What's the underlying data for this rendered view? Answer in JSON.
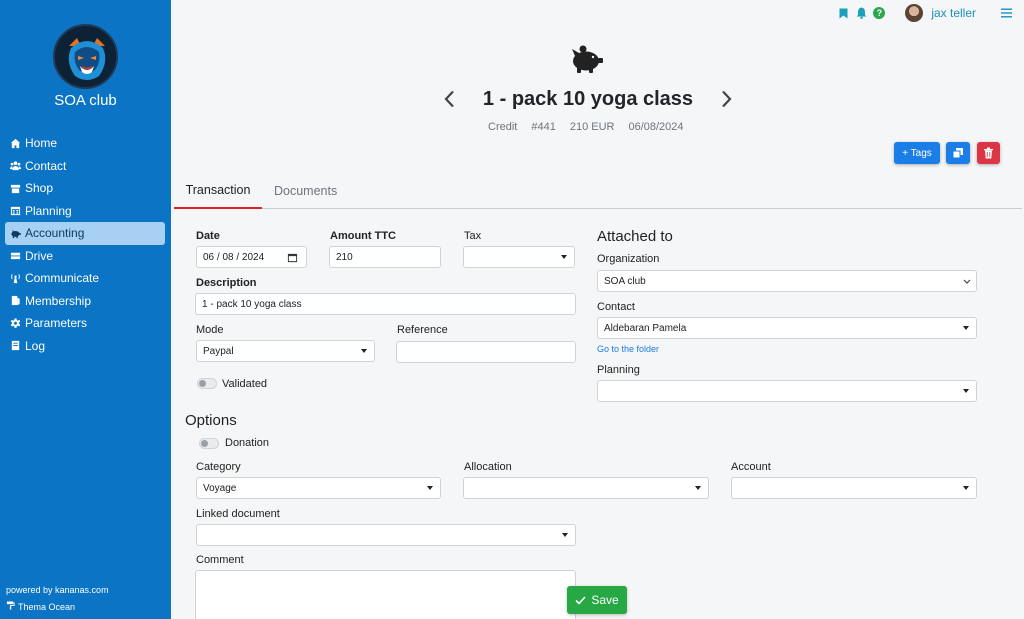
{
  "sidebar": {
    "club_name": "SOA club",
    "items": [
      {
        "label": "Home",
        "icon": "home-icon"
      },
      {
        "label": "Contact",
        "icon": "users-icon"
      },
      {
        "label": "Shop",
        "icon": "shop-icon"
      },
      {
        "label": "Planning",
        "icon": "calendar-icon"
      },
      {
        "label": "Accounting",
        "icon": "piggy-bank-icon"
      },
      {
        "label": "Drive",
        "icon": "drive-icon"
      },
      {
        "label": "Communicate",
        "icon": "broadcast-icon"
      },
      {
        "label": "Membership",
        "icon": "id-card-icon"
      },
      {
        "label": "Parameters",
        "icon": "gear-icon"
      },
      {
        "label": "Log",
        "icon": "log-icon"
      }
    ],
    "active_item": "Accounting",
    "powered": "powered by kananas.com",
    "theme": "Thema Ocean"
  },
  "topbar": {
    "user_name": "jax teller",
    "help_glyph": "?"
  },
  "header": {
    "title": "1 - pack 10 yoga class",
    "type": "Credit",
    "number": "#441",
    "amount": "210 EUR",
    "date": "06/08/2024",
    "tags_label": "+ Tags"
  },
  "tabs": {
    "transaction": "Transaction",
    "documents": "Documents"
  },
  "form": {
    "date_label": "Date",
    "date_value": "06 / 08 / 2024",
    "amount_label": "Amount TTC",
    "amount_value": "210",
    "tax_label": "Tax",
    "tax_value": "",
    "description_label": "Description",
    "description_value": "1 - pack 10 yoga class",
    "mode_label": "Mode",
    "mode_value": "Paypal",
    "reference_label": "Reference",
    "reference_value": "",
    "validated_label": "Validated",
    "attached_title": "Attached to",
    "organization_label": "Organization",
    "organization_value": "SOA club",
    "contact_label": "Contact",
    "contact_value": "Aldebaran Pamela",
    "folder_link": "Go to the folder",
    "planning_label": "Planning",
    "planning_value": "",
    "options_title": "Options",
    "donation_label": "Donation",
    "category_label": "Category",
    "category_value": "Voyage",
    "allocation_label": "Allocation",
    "allocation_value": "",
    "account_label": "Account",
    "account_value": "",
    "linked_label": "Linked document",
    "linked_value": "",
    "comment_label": "Comment"
  },
  "save_label": "Save",
  "colors": {
    "sidebar": "#0b74c4",
    "active_item": "#a7d0f3",
    "primary": "#1a7ee6",
    "danger": "#dc3545",
    "success": "#28a745",
    "tab_underline": "#e02424"
  }
}
